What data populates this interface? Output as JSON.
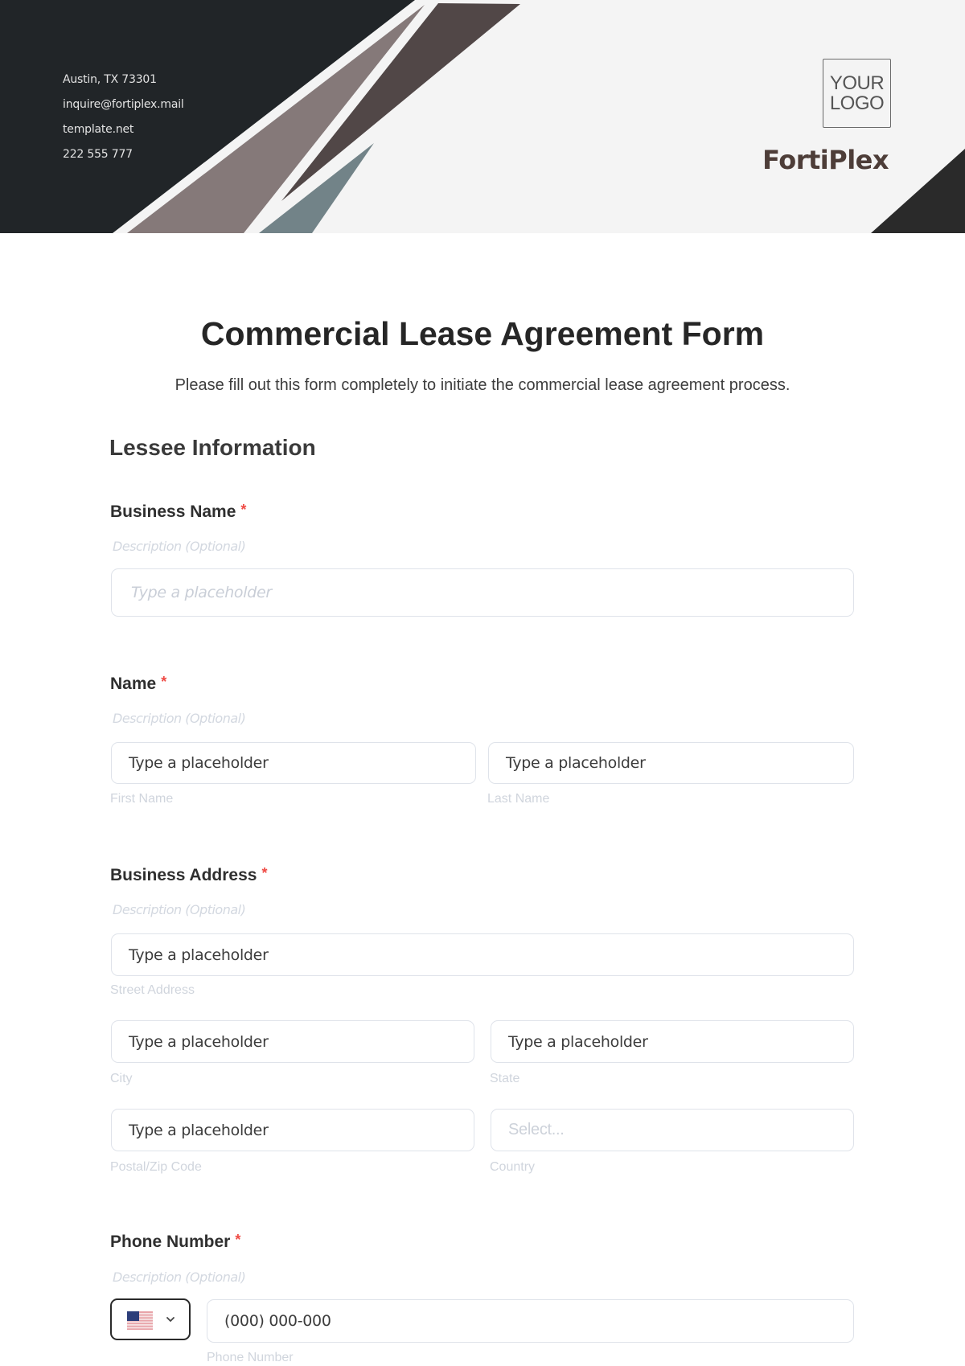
{
  "header": {
    "contact": {
      "address": "Austin, TX 73301",
      "email": "inquire@fortiplex.mail",
      "website": "template.net",
      "phone": "222 555 777"
    },
    "logo": {
      "line1": "YOUR",
      "line2": "LOGO"
    },
    "brand_name": "FortiPlex",
    "colors": {
      "dark": "#212528",
      "mauve": "#857979",
      "brown": "#514747",
      "slate": "#728388",
      "background": "#f4f4f4"
    }
  },
  "form": {
    "title": "Commercial Lease Agreement Form",
    "subtitle": "Please fill out this form completely to initiate the commercial lease agreement process.",
    "section_title": "Lessee Information",
    "required_marker": "*",
    "fields": {
      "business_name": {
        "label": "Business Name",
        "description": "Description (Optional)",
        "placeholder": "Type a placeholder"
      },
      "name": {
        "label": "Name",
        "description": "Description (Optional)",
        "first": {
          "value": "Type a placeholder",
          "sublabel": "First Name"
        },
        "last": {
          "value": "Type a placeholder",
          "sublabel": "Last Name"
        }
      },
      "business_address": {
        "label": "Business Address",
        "description": "Description (Optional)",
        "street": {
          "value": "Type a placeholder",
          "sublabel": "Street Address"
        },
        "city": {
          "value": "Type a placeholder",
          "sublabel": "City"
        },
        "state": {
          "value": "Type a placeholder",
          "sublabel": "State"
        },
        "zip": {
          "value": "Type a placeholder",
          "sublabel": "Postal/Zip Code"
        },
        "country": {
          "placeholder": "Select...",
          "sublabel": "Country"
        }
      },
      "phone": {
        "label": "Phone Number",
        "description": "Description (Optional)",
        "country_flag": "us-flag-icon",
        "value": "(000) 000-000",
        "sublabel": "Phone Number"
      }
    }
  }
}
